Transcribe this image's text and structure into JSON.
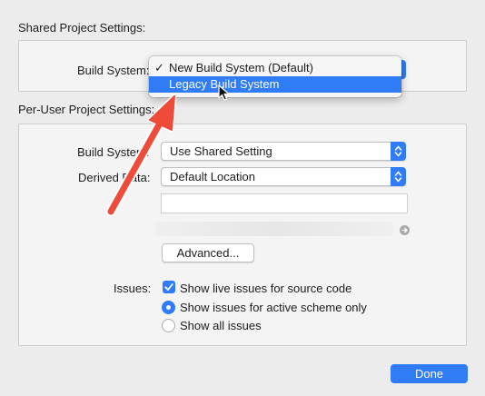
{
  "shared": {
    "title": "Shared Project Settings:",
    "build_system_label": "Build System:",
    "menu": {
      "items": [
        {
          "label": "New Build System (Default)",
          "checked": true
        },
        {
          "label": "Legacy Build System",
          "highlighted": true
        }
      ],
      "check_glyph": "✓"
    }
  },
  "per_user": {
    "title": "Per-User Project Settings:",
    "build_system_label": "Build System:",
    "build_system_value": "Use Shared Setting",
    "derived_data_label": "Derived Data:",
    "derived_data_value": "Default Location",
    "path_value": "",
    "advanced_button": "Advanced...",
    "issues_label": "Issues:",
    "issues_options": {
      "live_issues": {
        "label": "Show live issues for source code",
        "checked": true
      },
      "active_scheme": {
        "label": "Show issues for active scheme only",
        "selected": true
      },
      "all_issues": {
        "label": "Show all issues",
        "selected": false
      }
    }
  },
  "footer": {
    "done_button": "Done"
  },
  "colors": {
    "accent": "#2f7cf6",
    "annotation_arrow": "#ee4b3a"
  }
}
